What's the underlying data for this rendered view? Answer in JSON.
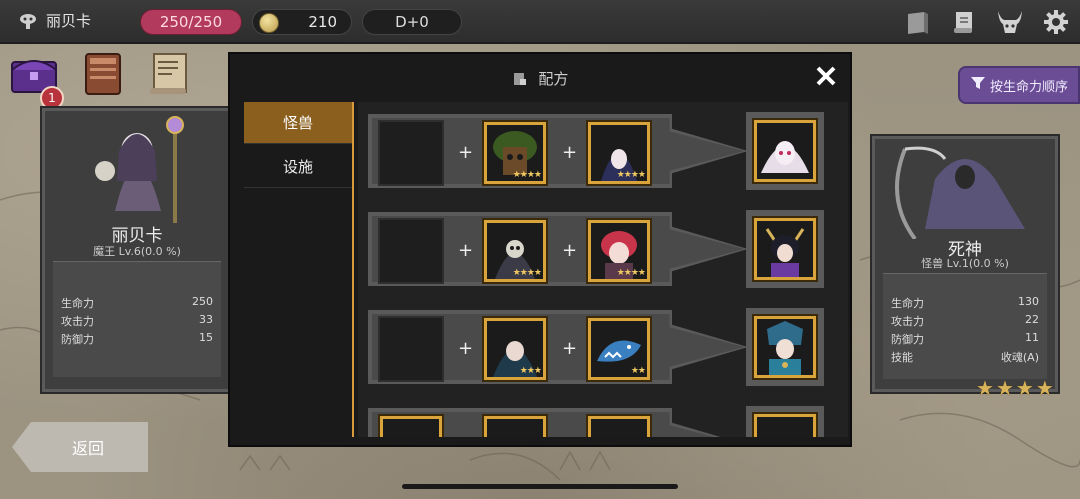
{
  "topbar": {
    "player_name": "丽贝卡",
    "hp": "250/250",
    "gold": "210",
    "day": "D+0"
  },
  "inventory": {
    "badge_count": "1"
  },
  "sort_button": {
    "label": "按生命力顺序"
  },
  "back_button": {
    "label": "返回"
  },
  "left_card": {
    "name": "丽贝卡",
    "subtitle": "魔王 Lv.6(0.0 %)",
    "stats": [
      {
        "label": "生命力",
        "value": "250"
      },
      {
        "label": "攻击力",
        "value": "33"
      },
      {
        "label": "防御力",
        "value": "15"
      }
    ]
  },
  "right_card": {
    "name": "死神",
    "subtitle": "怪兽 Lv.1(0.0 %)",
    "stats": [
      {
        "label": "生命力",
        "value": "130"
      },
      {
        "label": "攻击力",
        "value": "22"
      },
      {
        "label": "防御力",
        "value": "11"
      },
      {
        "label": "技能",
        "value": "收魂(A)"
      }
    ],
    "stars": 4
  },
  "modal": {
    "title": "配方",
    "tabs": [
      {
        "label": "怪兽",
        "active": true
      },
      {
        "label": "设施",
        "active": false
      }
    ],
    "recipes": [
      {
        "ingredient1": "empty",
        "ingredient2": "treant",
        "ingredient2_stars": 4,
        "ingredient3": "hooded-figure",
        "ingredient3_stars": 4,
        "result": "white-haired-girl"
      },
      {
        "ingredient1": "empty",
        "ingredient2": "reaper",
        "ingredient2_stars": 4,
        "ingredient3": "red-haired-girl",
        "ingredient3_stars": 4,
        "result": "horned-dark-girl"
      },
      {
        "ingredient1": "empty",
        "ingredient2": "dark-haired-girl",
        "ingredient2_stars": 3,
        "ingredient3": "blue-shark",
        "ingredient3_stars": 2,
        "result": "armored-mage"
      },
      {
        "ingredient1": "partial",
        "ingredient2": "partial",
        "ingredient3": "partial",
        "result": "partial"
      }
    ]
  },
  "colors": {
    "hp_pill": "#b23a5c",
    "tab_active": "#8b5f1e",
    "gold_frame": "#d9a43c",
    "sort_button": "#6a4d95"
  },
  "icons": {
    "player": "mask-icon",
    "coin": "coin-icon",
    "top": [
      "book-icon",
      "scroll-icon",
      "demon-icon",
      "gear-icon"
    ],
    "inventory": [
      "chest-icon",
      "tome-icon",
      "map-scroll-icon"
    ],
    "sort": "funnel-icon",
    "recipe": "recipe-icon",
    "close": "close-icon"
  }
}
